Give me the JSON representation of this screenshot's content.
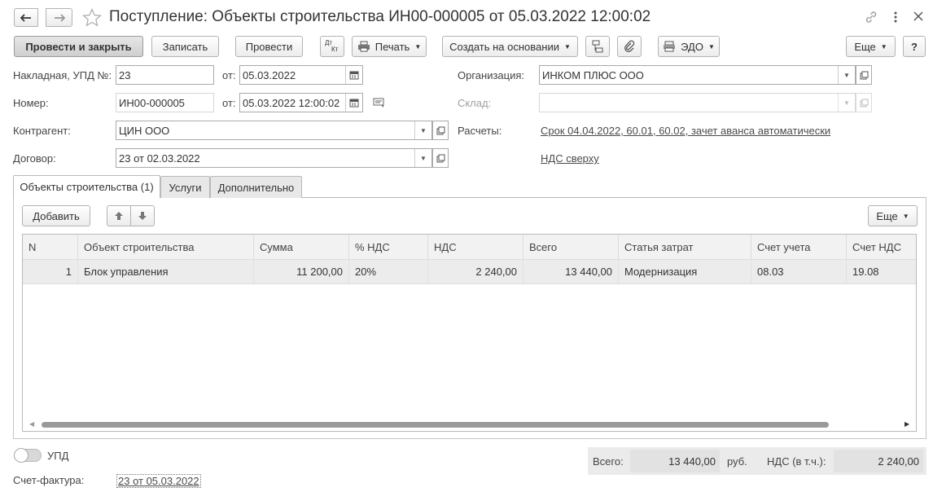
{
  "title": "Поступление: Объекты строительства ИН00-000005 от 05.03.2022 12:00:02",
  "toolbar": {
    "post_close": "Провести и закрыть",
    "save": "Записать",
    "post": "Провести",
    "dtkt_top": "Дт",
    "dtkt_bottom": "Кт",
    "print": "Печать",
    "create_based": "Создать на основании",
    "edo": "ЭДО",
    "more": "Еще",
    "help": "?"
  },
  "form": {
    "invoice_label": "Накладная, УПД №:",
    "invoice_no": "23",
    "from_label": "от:",
    "invoice_date": "05.03.2022",
    "number_label": "Номер:",
    "number": "ИН00-000005",
    "doc_datetime": "05.03.2022 12:00:02",
    "counterparty_label": "Контрагент:",
    "counterparty": "ЦИН ООО",
    "contract_label": "Договор:",
    "contract": "23 от 02.03.2022",
    "org_label": "Организация:",
    "org": "ИНКОМ ПЛЮС ООО",
    "warehouse_label": "Склад:",
    "warehouse": "",
    "settlements_label": "Расчеты:",
    "settlements_link": "Срок 04.04.2022, 60.01, 60.02, зачет аванса автоматически",
    "vat_link": "НДС сверху"
  },
  "tabs": [
    "Объекты строительства (1)",
    "Услуги",
    "Дополнительно"
  ],
  "table_toolbar": {
    "add": "Добавить",
    "more": "Еще"
  },
  "table": {
    "columns": [
      "N",
      "Объект строительства",
      "Сумма",
      "% НДС",
      "НДС",
      "Всего",
      "Статья затрат",
      "Счет учета",
      "Счет НДС"
    ],
    "rows": [
      [
        "1",
        "Блок управления",
        "11 200,00",
        "20%",
        "2 240,00",
        "13 440,00",
        "Модернизация",
        "08.03",
        "19.08"
      ]
    ]
  },
  "footer": {
    "upd_label": "УПД",
    "upd_toggle_on": false,
    "invoice_label": "Счет-фактура:",
    "invoice_link": "23 от 05.03.2022",
    "total_label": "Всего:",
    "total": "13 440,00",
    "currency": "руб.",
    "vat_label": "НДС (в т.ч.):",
    "vat": "2 240,00"
  },
  "colors": {
    "primary_button": "#d6d6d6",
    "selected_row": "#ececec",
    "totals_bg": "#ebebeb"
  }
}
